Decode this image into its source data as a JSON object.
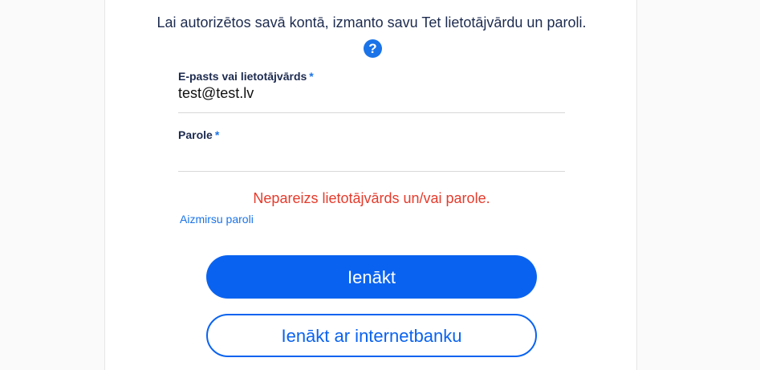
{
  "login": {
    "intro_text": "Lai autorizētos savā kontā, izmanto savu Tet lietotājvārdu un paroli.",
    "help_icon": "question-circle-icon",
    "help_glyph": "?",
    "email_label": "E-pasts vai lietotājvārds",
    "email_value": "test@test.lv",
    "password_label": "Parole",
    "password_value": "",
    "required_marker": "*",
    "error_message": "Nepareizs lietotājvārds un/vai parole.",
    "forgot_password": "Aizmirsu paroli",
    "login_button": "Ienākt",
    "bank_login_button": "Ienākt ar internetbanku"
  },
  "colors": {
    "primary": "#0a63f0",
    "error": "#e53b2c",
    "text": "#1d2b4f"
  }
}
